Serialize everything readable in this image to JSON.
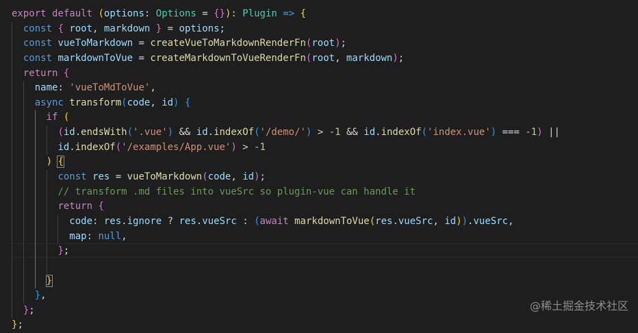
{
  "colors": {
    "background": "#1e1e1e",
    "keyword": "#c586c0",
    "storage": "#569cd6",
    "variable": "#9cdcfe",
    "function": "#dcdcaa",
    "type": "#4ec9b0",
    "string": "#ce9178",
    "number": "#b5cea8",
    "comment": "#6a9955",
    "punct": "#d4d4d4",
    "bracket1": "#ffd700",
    "bracket2": "#da70d6",
    "bracket3": "#179fff"
  },
  "code": {
    "lines": [
      [
        {
          "t": "export",
          "k": "keyword"
        },
        {
          "t": " ",
          "k": "punct"
        },
        {
          "t": "default",
          "k": "keyword"
        },
        {
          "t": " ",
          "k": "punct"
        },
        {
          "t": "(",
          "k": "bracket1"
        },
        {
          "t": "options",
          "k": "variable"
        },
        {
          "t": ": ",
          "k": "punct"
        },
        {
          "t": "Options",
          "k": "type"
        },
        {
          "t": " = ",
          "k": "punct"
        },
        {
          "t": "{}",
          "k": "bracket2"
        },
        {
          "t": ")",
          "k": "bracket1"
        },
        {
          "t": ": ",
          "k": "punct"
        },
        {
          "t": "Plugin",
          "k": "type"
        },
        {
          "t": " ",
          "k": "punct"
        },
        {
          "t": "=>",
          "k": "storage"
        },
        {
          "t": " ",
          "k": "punct"
        },
        {
          "t": "{",
          "k": "bracket1"
        }
      ],
      [
        {
          "t": "const",
          "k": "storage"
        },
        {
          "t": " ",
          "k": "punct"
        },
        {
          "t": "{",
          "k": "bracket2"
        },
        {
          "t": " root",
          "k": "variable"
        },
        {
          "t": ", ",
          "k": "punct"
        },
        {
          "t": "markdown",
          "k": "variable"
        },
        {
          "t": " ",
          "k": "punct"
        },
        {
          "t": "}",
          "k": "bracket2"
        },
        {
          "t": " = ",
          "k": "punct"
        },
        {
          "t": "options",
          "k": "variable"
        },
        {
          "t": ";",
          "k": "punct"
        }
      ],
      [
        {
          "t": "const",
          "k": "storage"
        },
        {
          "t": " ",
          "k": "punct"
        },
        {
          "t": "vueToMarkdown",
          "k": "variable"
        },
        {
          "t": " = ",
          "k": "punct"
        },
        {
          "t": "createVueToMarkdownRenderFn",
          "k": "function"
        },
        {
          "t": "(",
          "k": "bracket2"
        },
        {
          "t": "root",
          "k": "variable"
        },
        {
          "t": ")",
          "k": "bracket2"
        },
        {
          "t": ";",
          "k": "punct"
        }
      ],
      [
        {
          "t": "const",
          "k": "storage"
        },
        {
          "t": " ",
          "k": "punct"
        },
        {
          "t": "markdownToVue",
          "k": "variable"
        },
        {
          "t": " = ",
          "k": "punct"
        },
        {
          "t": "createMarkdownToVueRenderFn",
          "k": "function"
        },
        {
          "t": "(",
          "k": "bracket2"
        },
        {
          "t": "root",
          "k": "variable"
        },
        {
          "t": ", ",
          "k": "punct"
        },
        {
          "t": "markdown",
          "k": "variable"
        },
        {
          "t": ")",
          "k": "bracket2"
        },
        {
          "t": ";",
          "k": "punct"
        }
      ],
      [
        {
          "t": "return",
          "k": "keyword"
        },
        {
          "t": " ",
          "k": "punct"
        },
        {
          "t": "{",
          "k": "bracket2"
        }
      ],
      [
        {
          "t": "name",
          "k": "variable"
        },
        {
          "t": ": ",
          "k": "punct"
        },
        {
          "t": "'vueToMdToVue'",
          "k": "string"
        },
        {
          "t": ",",
          "k": "punct"
        }
      ],
      [
        {
          "t": "async",
          "k": "storage"
        },
        {
          "t": " ",
          "k": "punct"
        },
        {
          "t": "transform",
          "k": "function"
        },
        {
          "t": "(",
          "k": "bracket3"
        },
        {
          "t": "code",
          "k": "variable"
        },
        {
          "t": ", ",
          "k": "punct"
        },
        {
          "t": "id",
          "k": "variable"
        },
        {
          "t": ")",
          "k": "bracket3"
        },
        {
          "t": " ",
          "k": "punct"
        },
        {
          "t": "{",
          "k": "bracket3"
        }
      ],
      [
        {
          "t": "if",
          "k": "keyword"
        },
        {
          "t": " ",
          "k": "punct"
        },
        {
          "t": "(",
          "k": "bracket1"
        }
      ],
      [
        {
          "t": "(",
          "k": "bracket2"
        },
        {
          "t": "id",
          "k": "variable"
        },
        {
          "t": ".",
          "k": "punct"
        },
        {
          "t": "endsWith",
          "k": "function"
        },
        {
          "t": "(",
          "k": "bracket3"
        },
        {
          "t": "'.vue'",
          "k": "string"
        },
        {
          "t": ")",
          "k": "bracket3"
        },
        {
          "t": " && ",
          "k": "punct"
        },
        {
          "t": "id",
          "k": "variable"
        },
        {
          "t": ".",
          "k": "punct"
        },
        {
          "t": "indexOf",
          "k": "function"
        },
        {
          "t": "(",
          "k": "bracket3"
        },
        {
          "t": "'/demo/'",
          "k": "string"
        },
        {
          "t": ")",
          "k": "bracket3"
        },
        {
          "t": " > ",
          "k": "punct"
        },
        {
          "t": "-1",
          "k": "number"
        },
        {
          "t": " && ",
          "k": "punct"
        },
        {
          "t": "id",
          "k": "variable"
        },
        {
          "t": ".",
          "k": "punct"
        },
        {
          "t": "indexOf",
          "k": "function"
        },
        {
          "t": "(",
          "k": "bracket3"
        },
        {
          "t": "'index.vue'",
          "k": "string"
        },
        {
          "t": ")",
          "k": "bracket3"
        },
        {
          "t": " === ",
          "k": "punct"
        },
        {
          "t": "-1",
          "k": "number"
        },
        {
          "t": ")",
          "k": "bracket2"
        },
        {
          "t": " ||",
          "k": "punct"
        }
      ],
      [
        {
          "t": "id",
          "k": "variable"
        },
        {
          "t": ".",
          "k": "punct"
        },
        {
          "t": "indexOf",
          "k": "function"
        },
        {
          "t": "(",
          "k": "bracket2"
        },
        {
          "t": "'/examples/App.vue'",
          "k": "string"
        },
        {
          "t": ")",
          "k": "bracket2"
        },
        {
          "t": " > ",
          "k": "punct"
        },
        {
          "t": "-1",
          "k": "number"
        }
      ],
      [
        {
          "t": ")",
          "k": "bracket1"
        },
        {
          "t": " ",
          "k": "punct"
        },
        {
          "t": "{",
          "k": "bracket1"
        }
      ],
      [
        {
          "t": "const",
          "k": "storage"
        },
        {
          "t": " ",
          "k": "punct"
        },
        {
          "t": "res",
          "k": "variable"
        },
        {
          "t": " = ",
          "k": "punct"
        },
        {
          "t": "vueToMarkdown",
          "k": "function"
        },
        {
          "t": "(",
          "k": "bracket2"
        },
        {
          "t": "code",
          "k": "variable"
        },
        {
          "t": ", ",
          "k": "punct"
        },
        {
          "t": "id",
          "k": "variable"
        },
        {
          "t": ")",
          "k": "bracket2"
        },
        {
          "t": ";",
          "k": "punct"
        }
      ],
      [
        {
          "t": "// transform .md files into vueSrc so plugin-vue can handle it",
          "k": "comment"
        }
      ],
      [
        {
          "t": "return",
          "k": "keyword"
        },
        {
          "t": " ",
          "k": "punct"
        },
        {
          "t": "{",
          "k": "bracket2"
        }
      ],
      [
        {
          "t": "code",
          "k": "variable"
        },
        {
          "t": ": ",
          "k": "punct"
        },
        {
          "t": "res",
          "k": "variable"
        },
        {
          "t": ".",
          "k": "punct"
        },
        {
          "t": "ignore",
          "k": "variable"
        },
        {
          "t": " ? ",
          "k": "punct"
        },
        {
          "t": "res",
          "k": "variable"
        },
        {
          "t": ".",
          "k": "punct"
        },
        {
          "t": "vueSrc",
          "k": "variable"
        },
        {
          "t": " : ",
          "k": "punct"
        },
        {
          "t": "(",
          "k": "bracket3"
        },
        {
          "t": "await",
          "k": "keyword"
        },
        {
          "t": " ",
          "k": "punct"
        },
        {
          "t": "markdownToVue",
          "k": "function"
        },
        {
          "t": "(",
          "k": "bracket1"
        },
        {
          "t": "res",
          "k": "variable"
        },
        {
          "t": ".",
          "k": "punct"
        },
        {
          "t": "vueSrc",
          "k": "variable"
        },
        {
          "t": ", ",
          "k": "punct"
        },
        {
          "t": "id",
          "k": "variable"
        },
        {
          "t": ")",
          "k": "bracket1"
        },
        {
          "t": ")",
          "k": "bracket3"
        },
        {
          "t": ".",
          "k": "punct"
        },
        {
          "t": "vueSrc",
          "k": "variable"
        },
        {
          "t": ",",
          "k": "punct"
        }
      ],
      [
        {
          "t": "map",
          "k": "variable"
        },
        {
          "t": ": ",
          "k": "punct"
        },
        {
          "t": "null",
          "k": "storage"
        },
        {
          "t": ",",
          "k": "punct"
        }
      ],
      [
        {
          "t": "}",
          "k": "bracket2"
        },
        {
          "t": ";",
          "k": "punct"
        }
      ],
      [],
      [
        {
          "t": "}",
          "k": "bracket1"
        }
      ],
      [
        {
          "t": "}",
          "k": "bracket3"
        },
        {
          "t": ",",
          "k": "punct"
        }
      ],
      [
        {
          "t": "}",
          "k": "bracket2"
        },
        {
          "t": ";",
          "k": "punct"
        }
      ],
      [
        {
          "t": "}",
          "k": "bracket1"
        },
        {
          "t": ";",
          "k": "punct"
        }
      ]
    ]
  },
  "watermark": "@稀土掘金技术社区"
}
